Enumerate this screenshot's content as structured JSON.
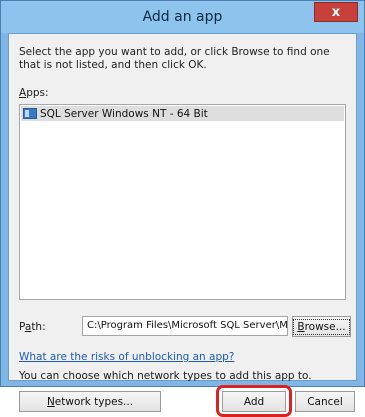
{
  "window": {
    "title": "Add an app",
    "close_glyph": "x"
  },
  "dialog": {
    "instructions": "Select the app you want to add, or click Browse to find one that is not listed, and then click OK.",
    "apps_label_accel": "A",
    "apps_label_rest": "pps:",
    "apps": [
      {
        "name": "SQL Server Windows NT - 64 Bit",
        "icon": "application-icon"
      }
    ],
    "path_label_prefix": "P",
    "path_label_accel": "a",
    "path_label_rest": "th:",
    "path_value": "C:\\Program Files\\Microsoft SQL Server\\MSSQL",
    "browse_accel": "B",
    "browse_rest": "rowse...",
    "risk_link": "What are the risks of unblocking an app?",
    "network_info": "You can choose which network types to add this app to.",
    "network_types_accel": "N",
    "network_types_rest": "etwork types...",
    "add_label": "Add",
    "cancel_label": "Cancel"
  },
  "colors": {
    "highlight": "#d8231f",
    "link": "#1e5bb8",
    "titlebar": "#8ec3ee"
  }
}
